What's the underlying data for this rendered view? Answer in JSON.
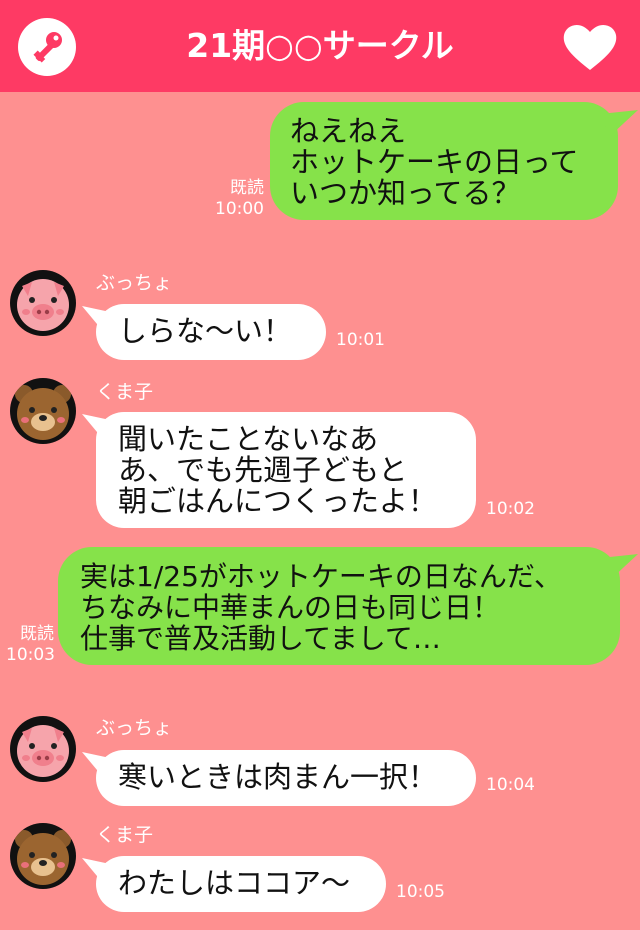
{
  "header": {
    "title": "21期○○サークル",
    "left_icon": "key-icon",
    "right_icon": "heart-icon"
  },
  "messages": [
    {
      "sender": "me",
      "text": "ねえねえ\nホットケーキの日って\nいつか知ってる？",
      "read": "既読",
      "time": "10:00"
    },
    {
      "sender": "ぶっちょ",
      "avatar": "pig-icon",
      "text": "しらな～い！",
      "time": "10:01"
    },
    {
      "sender": "くま子",
      "avatar": "bear-icon",
      "text": "聞いたことないなあ\nあ、でも先週子どもと\n朝ごはんにつくったよ！",
      "time": "10:02"
    },
    {
      "sender": "me",
      "text": "実は1/25がホットケーキの日なんだ、\nちなみに中華まんの日も同じ日！\n仕事で普及活動してまして…",
      "read": "既読",
      "time": "10:03"
    },
    {
      "sender": "ぶっちょ",
      "avatar": "pig-icon",
      "text": "寒いときは肉まん一択！",
      "time": "10:04"
    },
    {
      "sender": "くま子",
      "avatar": "bear-icon",
      "text": "わたしはココア～",
      "time": "10:05"
    }
  ],
  "colors": {
    "header": "#fe3a64",
    "background": "#fe9090",
    "my_bubble": "#86e24a",
    "other_bubble": "#ffffff"
  }
}
